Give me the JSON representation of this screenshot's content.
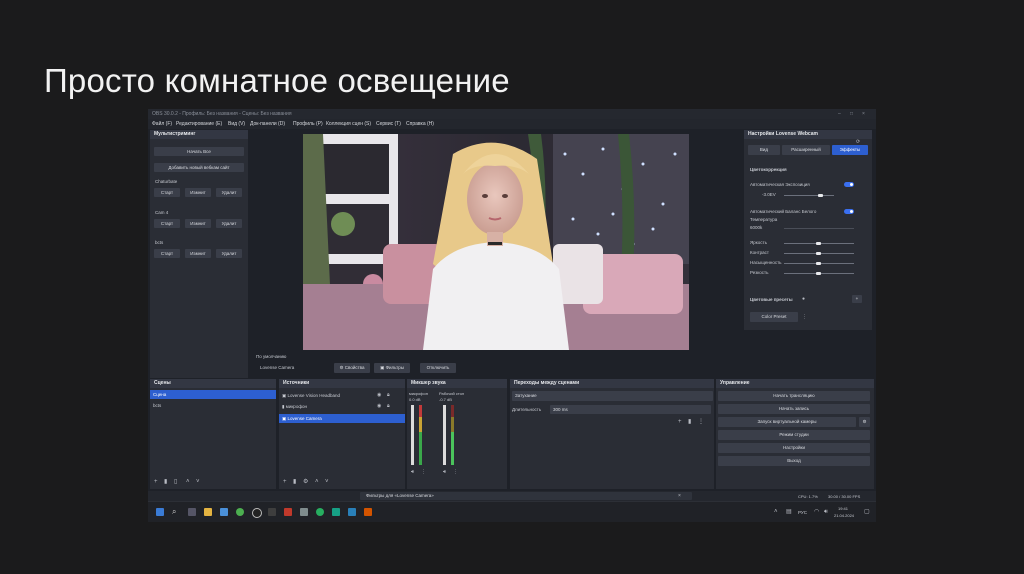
{
  "slide": {
    "title": "Просто комнатное освещение"
  },
  "window": {
    "title": "OBS 30.0.2 - Профиль: Без названия - Сцены: Без названия",
    "menu": [
      "Файл (F)",
      "Редактирование (E)",
      "Вид (V)",
      "Док-панели (D)",
      "Профиль (P)",
      "Коллекция сцен (S)",
      "Сервис (T)",
      "Справка (H)"
    ]
  },
  "multistream": {
    "header": "Мультистриминг",
    "start_all": "Начать Все",
    "add_site": "Добавить новый вебкам сайт",
    "sites": [
      {
        "name": "Chaturbate",
        "start": "Старт",
        "edit": "Измнит",
        "delete": "Удалит"
      },
      {
        "name": "Cam 4",
        "start": "Старт",
        "edit": "Измнит",
        "delete": "Удалит"
      },
      {
        "name": "bcts",
        "start": "Старт",
        "edit": "Измнит",
        "delete": "Удалит"
      }
    ]
  },
  "preview_bar": {
    "label": "Lovense Camera",
    "properties": "Свойства",
    "filters": "Фильтры",
    "deactivate": "Отключить",
    "device": "По умолчанию"
  },
  "webcam_settings": {
    "header": "Настройки Lovense Webcam",
    "tabs": [
      "Вид",
      "Расширенный",
      "Эффекты"
    ],
    "color_correction": "Цветокоррекция",
    "auto_exposure": "Автоматическая Экспозиция",
    "exposure_value": "-3.0EV",
    "auto_wb": "Автоматический Баланс Белого",
    "temperature": "Температура",
    "temperature_value": "6000k",
    "sliders": [
      "Яркость",
      "Контраст",
      "Насыщенность",
      "Резкость"
    ],
    "color_presets": "Цветовые пресеты",
    "color_preset_btn": "Color Preset"
  },
  "scenes": {
    "header": "Сцены",
    "items": [
      "Сцена",
      "bcts"
    ]
  },
  "sources": {
    "header": "Источники",
    "items": [
      "Lovense Vision Headband",
      "микрофон",
      "Lovense Camera"
    ]
  },
  "mixer": {
    "header": "Микшер звука",
    "channels": [
      {
        "name": "микрофон",
        "db": "0.0 dB"
      },
      {
        "name": "Рабочий стол",
        "db": "-0.7 dB"
      }
    ]
  },
  "transitions": {
    "header": "Переходы между сценами",
    "selected": "Затухание",
    "duration_label": "Длительность",
    "duration_value": "300 ms"
  },
  "controls": {
    "header": "Управление",
    "buttons": [
      "Начать трансляцию",
      "Начать запись",
      "Запуск виртуальной камеры",
      "Режим студии",
      "Настройки",
      "Выход"
    ]
  },
  "notification": "Фильтры для «Lovense Camera»",
  "status": {
    "cpu": "CPU: 1.7%",
    "fps": "30.00 / 30.00 FPS"
  },
  "tray": {
    "lang": "РУС",
    "time": "19:41",
    "date": "21.04.2024"
  },
  "colors": {
    "accent": "#2d5fd0",
    "bg": "#1e2128",
    "panel": "#2a2d35"
  }
}
